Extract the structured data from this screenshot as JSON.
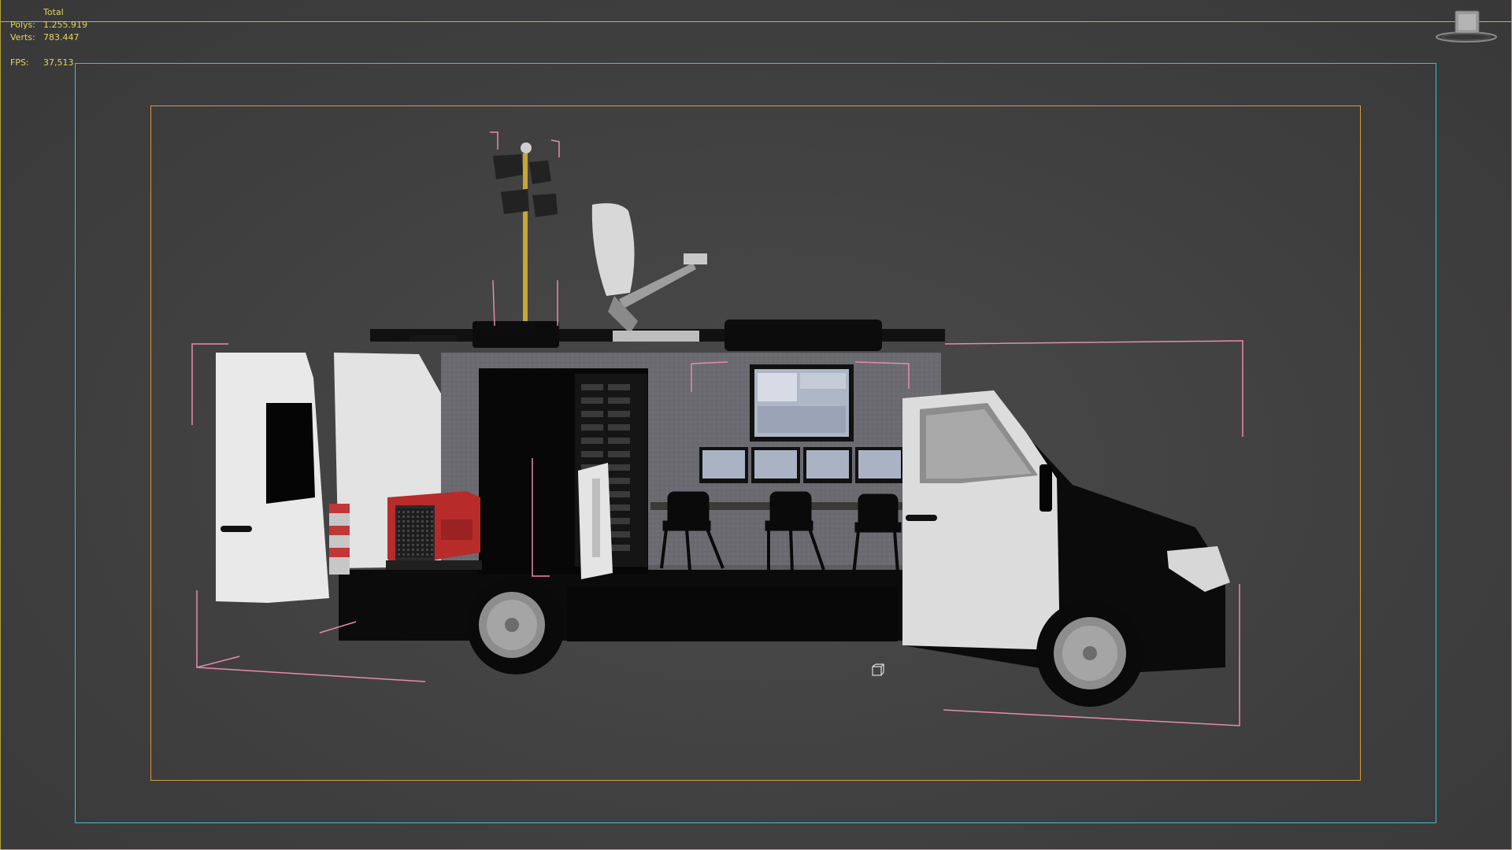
{
  "viewport": {
    "stats": {
      "title": "Total",
      "polys_label": "Polys:",
      "polys_value": "1.255.919",
      "verts_label": "Verts:",
      "verts_value": "783.447",
      "fps_label": "FPS:",
      "fps_value": "37,513"
    },
    "colors": {
      "stats_text": "#e7d55a",
      "safe_frame": "#38c2d6",
      "action_safe_frame": "#d99a3a",
      "selection_bracket": "#e88ab0",
      "background": "#444444"
    },
    "icons": [
      "viewcube-icon",
      "pivot-cube-icon"
    ],
    "scene_objects": [
      "broadcast-van-model",
      "light-mast",
      "satellite-dish",
      "generator",
      "server-rack",
      "monitor-wall",
      "operator-chairs",
      "front-wheel",
      "rear-wheel"
    ]
  }
}
